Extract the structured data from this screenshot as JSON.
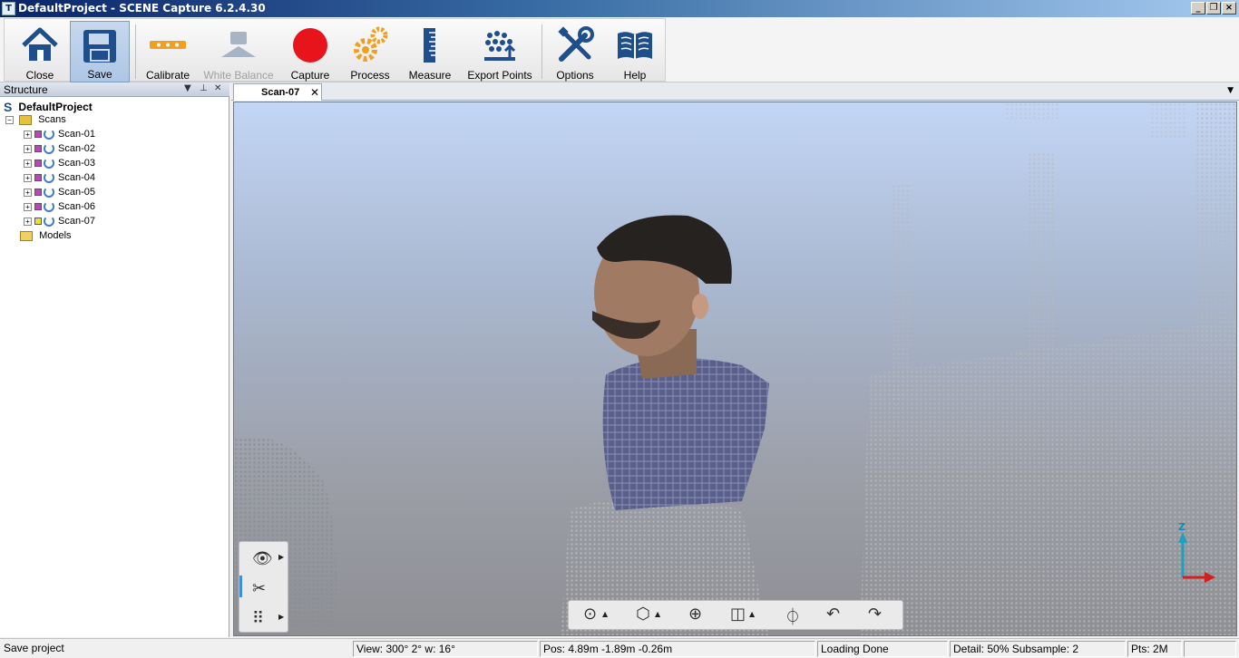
{
  "window": {
    "title": "DefaultProject - SCENE Capture 6.2.4.30"
  },
  "toolbar": {
    "buttons": [
      {
        "label": "Close",
        "icon": "home-icon"
      },
      {
        "label": "Save",
        "icon": "floppy-disk-icon",
        "state": "active"
      },
      {
        "label": "Calibrate",
        "icon": "calibrate-icon"
      },
      {
        "label": "White Balance",
        "icon": "white-balance-icon",
        "state": "disabled"
      },
      {
        "label": "Capture",
        "icon": "record-icon"
      },
      {
        "label": "Process",
        "icon": "gears-icon"
      },
      {
        "label": "Measure",
        "icon": "ruler-icon"
      },
      {
        "label": "Export Points",
        "icon": "export-points-icon"
      },
      {
        "label": "Options",
        "icon": "wrench-screwdriver-icon"
      },
      {
        "label": "Help",
        "icon": "book-icon"
      }
    ]
  },
  "structure": {
    "title": "Structure",
    "project": "DefaultProject",
    "scans_label": "Scans",
    "scans": [
      "Scan-01",
      "Scan-02",
      "Scan-03",
      "Scan-04",
      "Scan-05",
      "Scan-06",
      "Scan-07"
    ],
    "models_label": "Models"
  },
  "document": {
    "tab_label": "Scan-07"
  },
  "axis_gizmo": {
    "z_label": "Z"
  },
  "status": {
    "message": "Save project",
    "view": "View: 300° 2° w: 16°",
    "pos": "Pos: 4.89m -1.89m -0.26m",
    "loading": "Loading Done",
    "detail": "Detail:  50%  Subsample:  2",
    "pts": "Pts:   2M"
  },
  "colors": {
    "accent": "#3a80c0",
    "capture_red": "#e8141c",
    "icon_blue": "#1f4e8c",
    "icon_orange": "#f0a020"
  }
}
